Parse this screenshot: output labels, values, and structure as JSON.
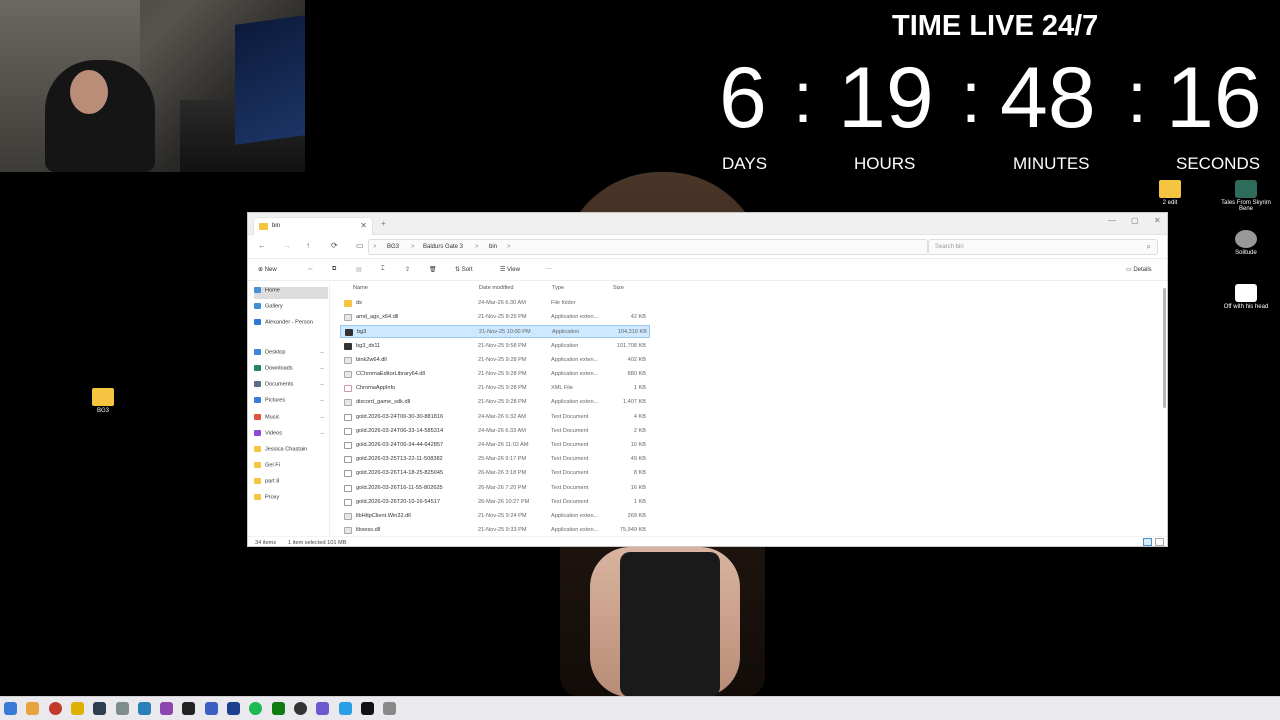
{
  "countdown": {
    "title": "TIME LIVE 24/7",
    "days": "6",
    "hours": "19",
    "minutes": "48",
    "seconds": "16",
    "separator": ":",
    "labels": {
      "days": "DAYS",
      "hours": "HOURS",
      "minutes": "MINUTES",
      "seconds": "SECONDS"
    }
  },
  "desktop_icons": {
    "bg3_folder": "BG3",
    "edit_folder": "2 edit",
    "tales": "Tales From Skyrim Bene",
    "solitude": "Solitude",
    "off_head": "Off with his head"
  },
  "explorer": {
    "tab_label": "bin",
    "tab_close": "✕",
    "new_tab": "+",
    "window_controls": {
      "minimize": "—",
      "maximize": "▢",
      "close": "✕"
    },
    "nav": {
      "back": "←",
      "forward": "→",
      "up": "↑",
      "refresh": "⟳",
      "view_pc": "▭"
    },
    "breadcrumb": [
      "BG3",
      "Baldurs Gate 3",
      "bin"
    ],
    "breadcrumb_sep": ">",
    "search_placeholder": "Search bin",
    "toolbar": {
      "new": "New",
      "sort": "Sort",
      "view": "View",
      "more": "···",
      "details": "Details"
    },
    "sidebar": [
      {
        "label": "Home",
        "icon": "home-icon",
        "color": "#4a90d9"
      },
      {
        "label": "Gallery",
        "icon": "gallery-icon",
        "color": "#3d8fd6"
      },
      {
        "label": "Alexander - Person",
        "icon": "cloud-icon",
        "color": "#2b7bd6"
      },
      {
        "label": "Desktop",
        "icon": "desktop-icon",
        "color": "#3a86d9"
      },
      {
        "label": "Downloads",
        "icon": "download-icon",
        "color": "#1f8a5b"
      },
      {
        "label": "Documents",
        "icon": "documents-icon",
        "color": "#5b6b8a"
      },
      {
        "label": "Pictures",
        "icon": "pictures-icon",
        "color": "#3b7dd8"
      },
      {
        "label": "Music",
        "icon": "music-icon",
        "color": "#e0533d"
      },
      {
        "label": "Videos",
        "icon": "videos-icon",
        "color": "#8b4ad8"
      },
      {
        "label": "Jessica Chastain",
        "icon": "folder-icon",
        "color": "#f5c542"
      },
      {
        "label": "Gel Fi",
        "icon": "folder-icon",
        "color": "#f5c542"
      },
      {
        "label": "part 8",
        "icon": "folder-icon",
        "color": "#f5c542"
      },
      {
        "label": "Proxy",
        "icon": "folder-icon",
        "color": "#f5c542"
      }
    ],
    "columns": {
      "name": "Name",
      "date": "Date modified",
      "type": "Type",
      "size": "Size"
    },
    "files": [
      {
        "name": "ds",
        "date": "24-Mar-26 6:30 AM",
        "type": "File folder",
        "size": "",
        "kind": "folder"
      },
      {
        "name": "amd_ags_x64.dll",
        "date": "21-Nov-25 8:25 PM",
        "type": "Application exten...",
        "size": "42 KB",
        "kind": "dll"
      },
      {
        "name": "bg3",
        "date": "21-Nov-25 10:00 PM",
        "type": "Application",
        "size": "104,310 KB",
        "kind": "exe"
      },
      {
        "name": "bg3_dx11",
        "date": "21-Nov-25 9:58 PM",
        "type": "Application",
        "size": "101,708 KB",
        "kind": "exe"
      },
      {
        "name": "bink2w64.dll",
        "date": "21-Nov-25 9:28 PM",
        "type": "Application exten...",
        "size": "402 KB",
        "kind": "dll"
      },
      {
        "name": "CChromaEditorLibrary64.dll",
        "date": "21-Nov-25 9:28 PM",
        "type": "Application exten...",
        "size": "880 KB",
        "kind": "dll"
      },
      {
        "name": "ChromaAppInfo",
        "date": "21-Nov-25 9:28 PM",
        "type": "XML File",
        "size": "1 KB",
        "kind": "xml"
      },
      {
        "name": "discord_game_sdk.dll",
        "date": "21-Nov-25 9:28 PM",
        "type": "Application exten...",
        "size": "1,407 KB",
        "kind": "dll"
      },
      {
        "name": "gold.2026-03-24T06-30-30-881816",
        "date": "24-Mar-26 6:32 AM",
        "type": "Text Document",
        "size": "4 KB",
        "kind": "txt"
      },
      {
        "name": "gold.2026-03-24T06-33-14-585314",
        "date": "24-Mar-26 6:33 AM",
        "type": "Text Document",
        "size": "2 KB",
        "kind": "txt"
      },
      {
        "name": "gold.2026-03-24T06-34-44-642857",
        "date": "24-Mar-26 11:02 AM",
        "type": "Text Document",
        "size": "10 KB",
        "kind": "txt"
      },
      {
        "name": "gold.2026-03-25T13-22-11-508382",
        "date": "25-Mar-26 9:17 PM",
        "type": "Text Document",
        "size": "49 KB",
        "kind": "txt"
      },
      {
        "name": "gold.2026-03-26T14-18-25-825045",
        "date": "26-Mar-26 3:18 PM",
        "type": "Text Document",
        "size": "8 KB",
        "kind": "txt"
      },
      {
        "name": "gold.2026-03-26T16-11-55-802625",
        "date": "26-Mar-26 7:20 PM",
        "type": "Text Document",
        "size": "16 KB",
        "kind": "txt"
      },
      {
        "name": "gold.2026-03-26T20-10-16-54517",
        "date": "26-Mar-26 10:27 PM",
        "type": "Text Document",
        "size": "1 KB",
        "kind": "txt"
      },
      {
        "name": "libHttpClient.Win32.dll",
        "date": "21-Nov-25 9:24 PM",
        "type": "Application exten...",
        "size": "269 KB",
        "kind": "dll"
      },
      {
        "name": "libxess.dll",
        "date": "21-Nov-25 9:33 PM",
        "type": "Application exten...",
        "size": "75,949 KB",
        "kind": "dll"
      }
    ],
    "selected_index": 2,
    "status": {
      "items": "34 items",
      "selection": "1 item selected 101 MB"
    }
  },
  "taskbar": {
    "icons": [
      "start-icon",
      "edit-icon",
      "record-icon",
      "notes-icon",
      "terminal-icon",
      "camera-icon",
      "app-icon",
      "bar-icon",
      "obs-icon",
      "headset-icon",
      "photoshop-icon",
      "music-icon",
      "xbox-icon",
      "chrome-icon",
      "browser-icon",
      "files-icon",
      "epic-icon",
      "settings-icon"
    ]
  }
}
